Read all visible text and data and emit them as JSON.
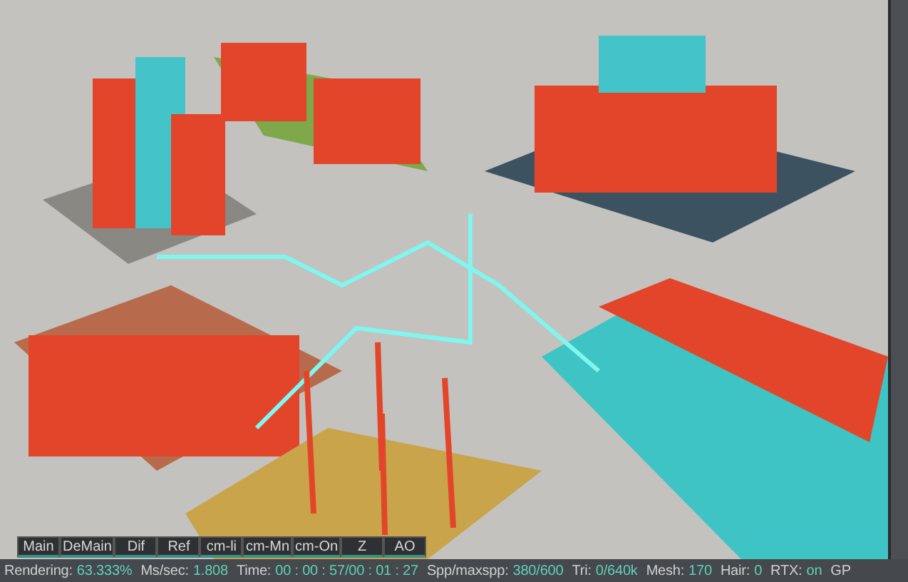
{
  "render_buttons": [
    {
      "label": "Main"
    },
    {
      "label": "DeMain"
    },
    {
      "label": "Dif"
    },
    {
      "label": "Ref"
    },
    {
      "label": "cm-li"
    },
    {
      "label": "cm-Mn"
    },
    {
      "label": "cm-On"
    },
    {
      "label": "Z"
    },
    {
      "label": "AO"
    }
  ],
  "status_bar": [
    {
      "label": "Rendering:",
      "value": "63.333%"
    },
    {
      "label": "Ms/sec:",
      "value": "1.808"
    },
    {
      "label": "Time:",
      "value": "00 : 00 : 57/00 : 01 : 27"
    },
    {
      "label": "Spp/maxspp:",
      "value": "380/600"
    },
    {
      "label": "Tri:",
      "value": "0/640k"
    },
    {
      "label": "Mesh:",
      "value": "170"
    },
    {
      "label": "Hair:",
      "value": "0"
    },
    {
      "label": "RTX:",
      "value": "on"
    },
    {
      "label": "GP"
    }
  ]
}
